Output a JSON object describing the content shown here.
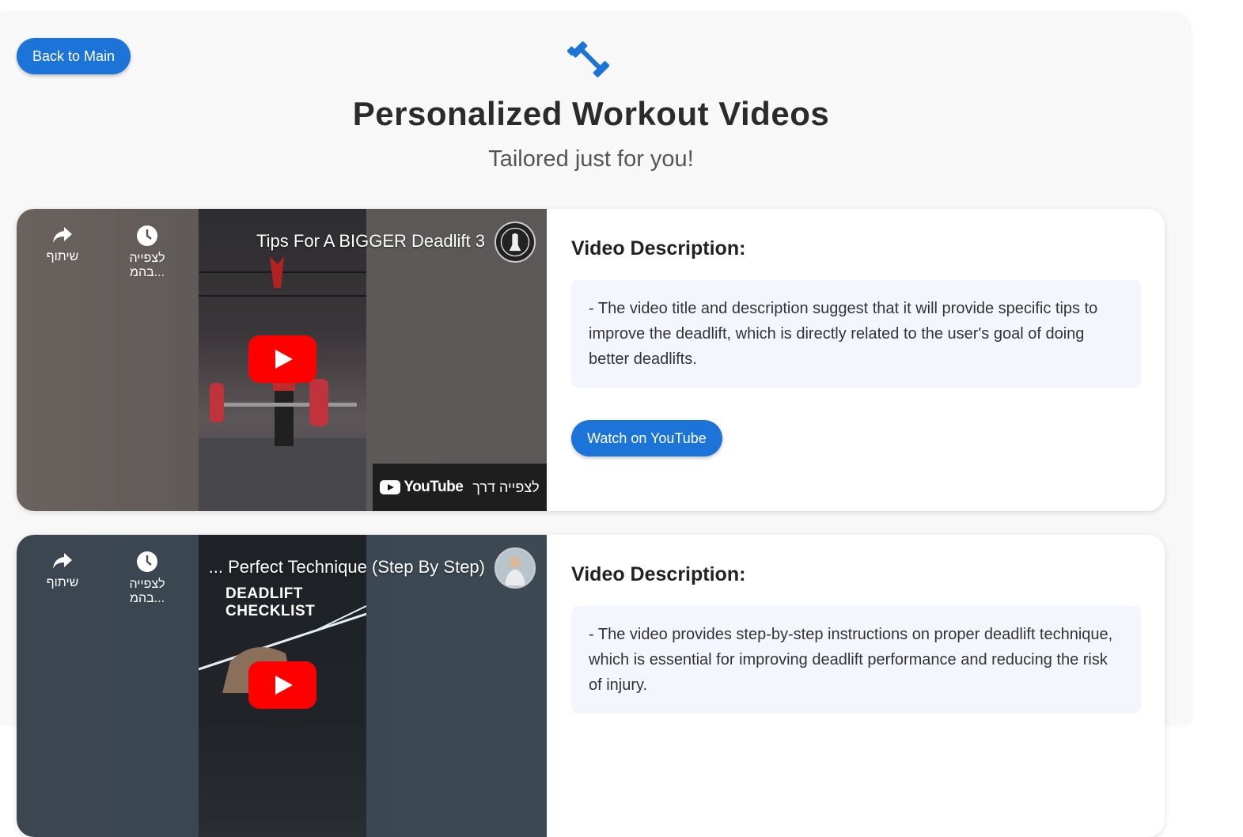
{
  "nav": {
    "back_label": "Back to Main"
  },
  "header": {
    "title": "Personalized Workout Videos",
    "subtitle": "Tailored just for you!",
    "icon": "dumbbell-icon",
    "accent_color": "#1c73d8"
  },
  "videos": [
    {
      "player_title": "Tips For A BIGGER Deadlift 3",
      "share_label": "שיתוף",
      "watch_later_label": "לצפייה בהמ...",
      "watch_via_label": "לצפייה דרך",
      "youtube_label": "YouTube",
      "description_heading": "Video Description:",
      "description": "- The video title and description suggest that it will provide specific tips to improve the deadlift, which is directly related to the user's goal of doing better deadlifts.",
      "watch_button": "Watch on YouTube"
    },
    {
      "player_title": "... Perfect Technique (Step By Step)",
      "thumb_text": "DEADLIFT CHECKLIST",
      "share_label": "שיתוף",
      "watch_later_label": "לצפייה בהמ...",
      "description_heading": "Video Description:",
      "description": "- The video provides step-by-step instructions on proper deadlift technique, which is essential for improving deadlift performance and reducing the risk of injury."
    }
  ]
}
